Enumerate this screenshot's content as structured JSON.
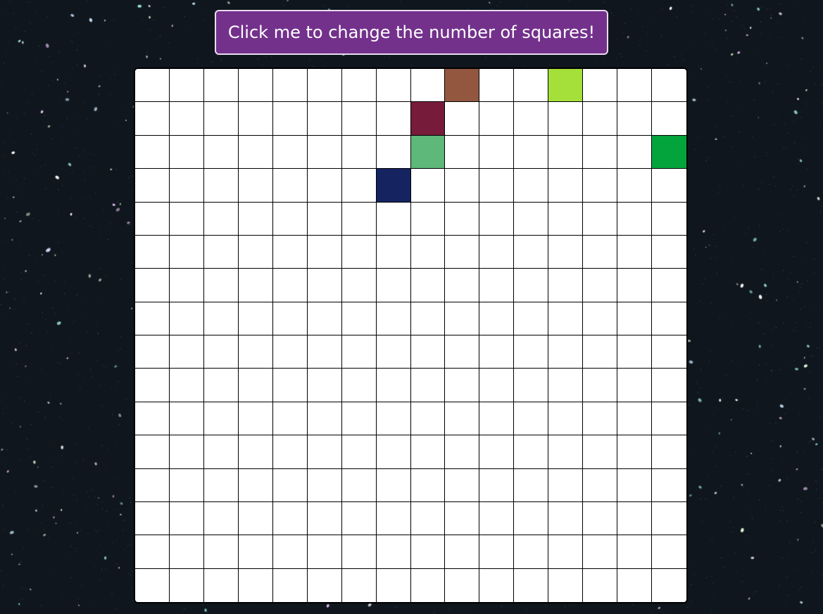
{
  "button": {
    "label": "Click me to change the number of squares!",
    "background": "#73318c",
    "text_color": "#ffffff"
  },
  "grid": {
    "rows": 16,
    "columns": 16,
    "default_color": "#ffffff",
    "line_color": "#000000",
    "colored_cells": [
      {
        "row": 0,
        "col": 9,
        "color": "#93573f"
      },
      {
        "row": 0,
        "col": 12,
        "color": "#a5e03a"
      },
      {
        "row": 1,
        "col": 8,
        "color": "#761b3a"
      },
      {
        "row": 2,
        "col": 8,
        "color": "#5db87a"
      },
      {
        "row": 2,
        "col": 15,
        "color": "#04a43c"
      },
      {
        "row": 3,
        "col": 7,
        "color": "#152460"
      }
    ]
  },
  "background": {
    "color": "#0f161d"
  }
}
